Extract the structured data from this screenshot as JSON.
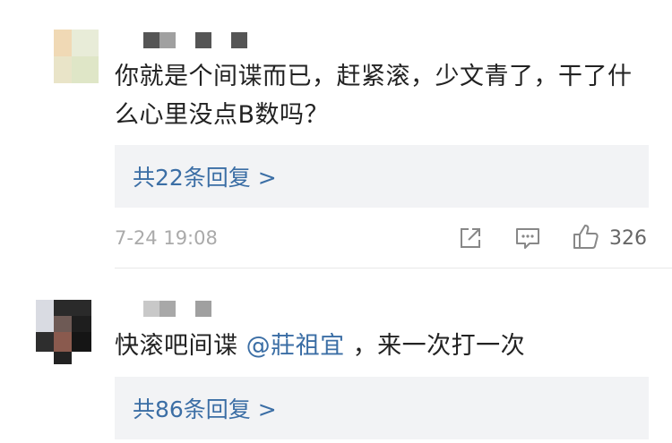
{
  "comments": [
    {
      "text": "你就是个间谍而已，赶紧滚，少文青了，干了什么心里没点B数吗？",
      "replies_label": "共22条回复 >",
      "time": "7-24 19:08",
      "likes": "326",
      "icons": [
        "share-icon",
        "comment-icon",
        "like-icon"
      ]
    },
    {
      "text_before": "快滚吧间谍",
      "mention": "@莊祖宜",
      "text_after": "，来一次打一次",
      "replies_label": "共86条回复 >"
    }
  ],
  "colors": {
    "link": "#3b6ea5",
    "reply_box_bg": "#f2f3f5",
    "meta_text": "#aaaaaa",
    "username_blocks": [
      "#555555",
      "#a0a0a0"
    ]
  }
}
